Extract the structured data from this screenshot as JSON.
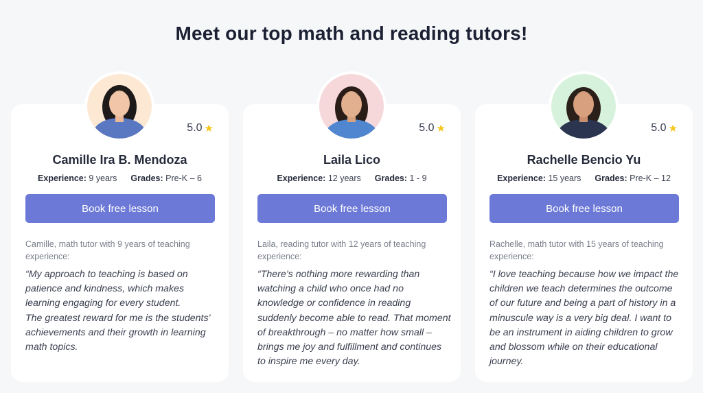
{
  "page": {
    "title": "Meet our top math and reading tutors!"
  },
  "labels": {
    "experience": "Experience:",
    "grades": "Grades:"
  },
  "star_icon": "star-icon",
  "colors": {
    "button": "#6c79d6",
    "star": "#f5c518",
    "background": "#f6f7f9"
  },
  "tutors": [
    {
      "name": "Camille Ira B. Mendoza",
      "rating": "5.0",
      "experience": "9 years",
      "grades": "Pre-K – 6",
      "button_label": "Book free lesson",
      "intro": "Camille, math tutor with 9 years of teaching experience:",
      "quote": "“My approach to teaching is based on patience and kindness, which makes learning engaging for every student.\nThe greatest reward for me is the students’ achievements and their growth in learning math topics.",
      "avatar_bg": "#fde8d4",
      "shirt": "#5a78c2"
    },
    {
      "name": "Laila Lico",
      "rating": "5.0",
      "experience": "12 years",
      "grades": "1 - 9",
      "button_label": "Book free lesson",
      "intro": "Laila, reading tutor with 12 years of teaching experience:",
      "quote": "“There’s nothing more rewarding than watching a child who once had no knowledge or confidence in reading suddenly become able to read. That moment of breakthrough – no matter how small – brings me joy and fulfillment and continues to inspire me every day.",
      "avatar_bg": "#f7d8da",
      "shirt": "#4f86cf"
    },
    {
      "name": "Rachelle Bencio Yu",
      "rating": "5.0",
      "experience": "15 years",
      "grades": "Pre-K – 12",
      "button_label": "Book free lesson",
      "intro": "Rachelle, math tutor with 15 years of teaching experience:",
      "quote": "“I love teaching because how we impact the children we teach determines the outcome of our future and being a part of history in a minuscule way is a very big deal. I want to be an instrument in aiding children to grow and blossom while on their educational journey.",
      "avatar_bg": "#d7f2dc",
      "shirt": "#2b3550"
    }
  ]
}
